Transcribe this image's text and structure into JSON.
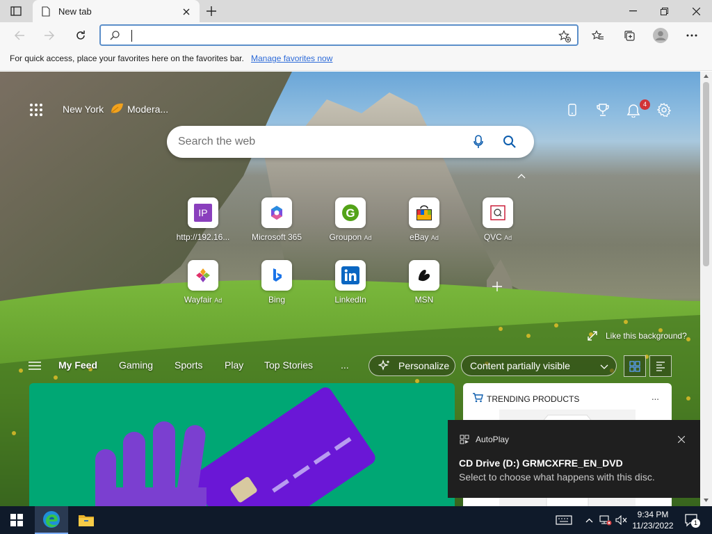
{
  "browser": {
    "tab_title": "New tab",
    "favorites_bar": {
      "message": "For quick access, place your favorites here on the favorites bar.",
      "link": "Manage favorites now"
    }
  },
  "ntp": {
    "location": "New York",
    "weather": "Modera...",
    "notification_count": "4",
    "search_placeholder": "Search the web",
    "tiles": [
      {
        "label": "http://192.16...",
        "ad": ""
      },
      {
        "label": "Microsoft 365",
        "ad": ""
      },
      {
        "label": "Groupon",
        "ad": "Ad"
      },
      {
        "label": "eBay",
        "ad": "Ad"
      },
      {
        "label": "QVC",
        "ad": "Ad"
      },
      {
        "label": "Wayfair",
        "ad": "Ad"
      },
      {
        "label": "Bing",
        "ad": ""
      },
      {
        "label": "LinkedIn",
        "ad": ""
      },
      {
        "label": "MSN",
        "ad": ""
      }
    ],
    "like_background": "Like this background?",
    "feed_nav": {
      "items": [
        "My Feed",
        "Gaming",
        "Sports",
        "Play",
        "Top Stories"
      ],
      "more": "...",
      "personalize": "Personalize",
      "content_visibility": "Content partially visible"
    },
    "trending": {
      "title": "TRENDING PRODUCTS",
      "more": "..."
    }
  },
  "toast": {
    "app": "AutoPlay",
    "title": "CD Drive (D:) GRMCXFRE_EN_DVD",
    "subtitle": "Select to choose what happens with this disc."
  },
  "taskbar": {
    "time": "9:34 PM",
    "date": "11/23/2022",
    "notification_badge": "1"
  },
  "colors": {
    "accent": "#0b5cad",
    "link": "#2c6ad8",
    "badge": "#d13438",
    "taskbar": "#0f1a2a"
  }
}
